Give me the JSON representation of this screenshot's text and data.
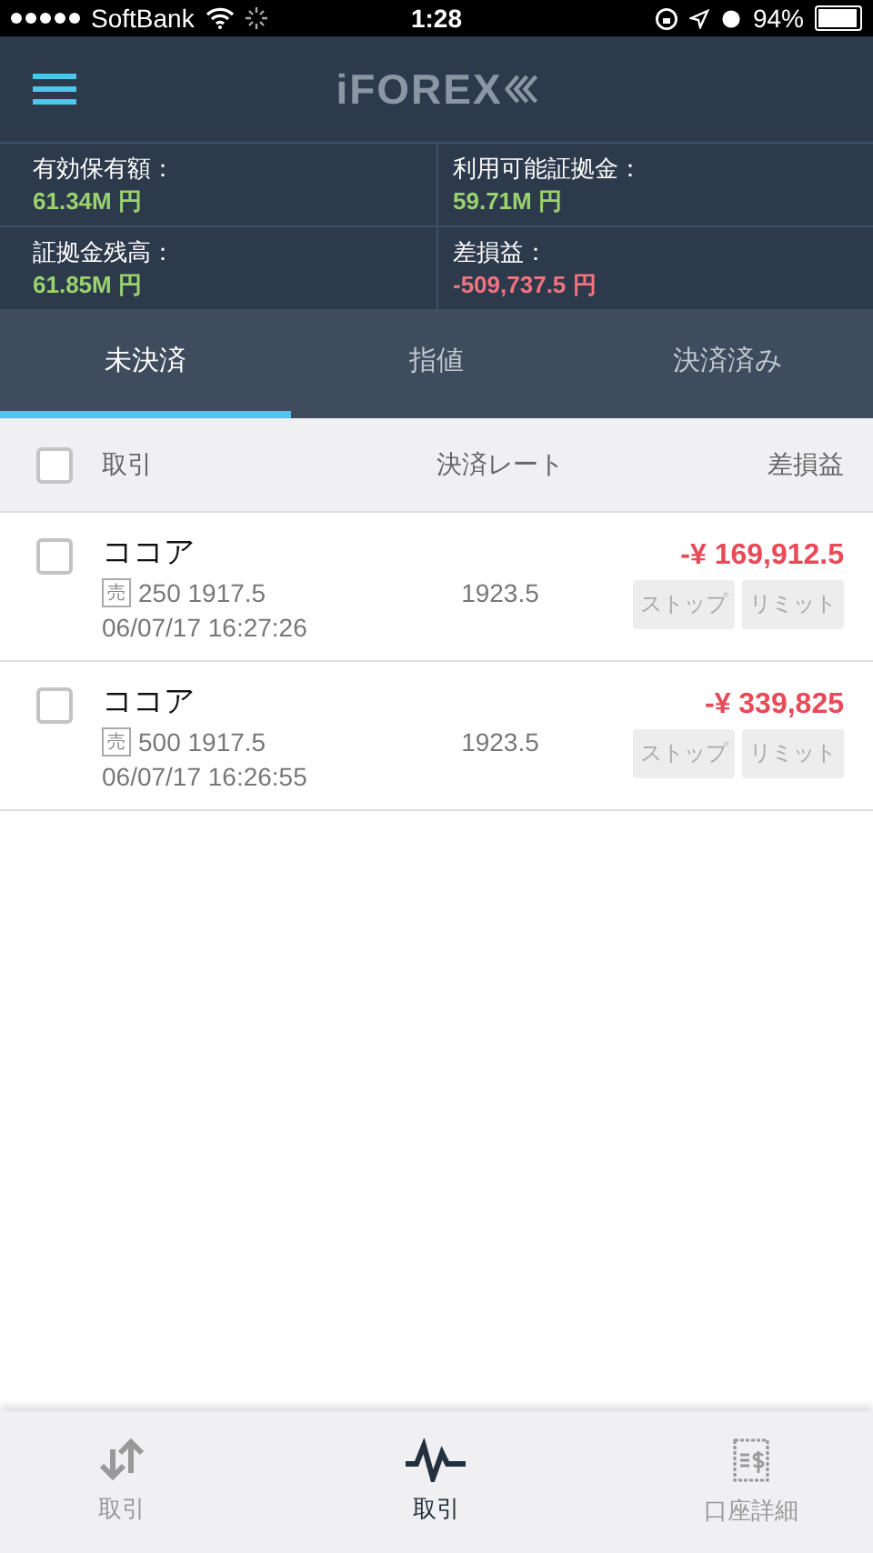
{
  "status_bar": {
    "carrier": "SoftBank",
    "time": "1:28",
    "battery": "94%"
  },
  "header": {
    "logo": "iFOREX"
  },
  "summary": [
    {
      "label": "有効保有額：",
      "value": "61.34M 円",
      "color": "#9ad26d"
    },
    {
      "label": "利用可能証拠金：",
      "value": "59.71M 円",
      "color": "#9ad26d"
    },
    {
      "label": "証拠金残高：",
      "value": "61.85M 円",
      "color": "#9ad26d"
    },
    {
      "label": "差損益：",
      "value": "-509,737.5 円",
      "color": "#f0737f"
    }
  ],
  "tabs": [
    {
      "label": "未決済",
      "selected": true
    },
    {
      "label": "指値",
      "selected": false
    },
    {
      "label": "決済済み",
      "selected": false
    }
  ],
  "table": {
    "select_all_checked": false,
    "columns": [
      "取引",
      "決済レート",
      "差損益"
    ],
    "rows": [
      {
        "checked": false,
        "instrument": "ココア",
        "side": "売",
        "detail": "250 1917.5",
        "time": "06/07/17 16:27:26",
        "rate": "1923.5",
        "pnl": "-¥ 169,912.5",
        "buttons": [
          "ストップ",
          "リミット"
        ]
      },
      {
        "checked": false,
        "instrument": "ココア",
        "side": "売",
        "detail": "500 1917.5",
        "time": "06/07/17 16:26:55",
        "rate": "1923.5",
        "pnl": "-¥ 339,825",
        "buttons": [
          "ストップ",
          "リミット"
        ]
      }
    ]
  },
  "bottom_nav": [
    {
      "kind": "arrows",
      "label": "取引",
      "selected": false
    },
    {
      "kind": "pulse",
      "label": "取引",
      "selected": true
    },
    {
      "kind": "receipt",
      "label": "口座詳細",
      "selected": false
    }
  ]
}
